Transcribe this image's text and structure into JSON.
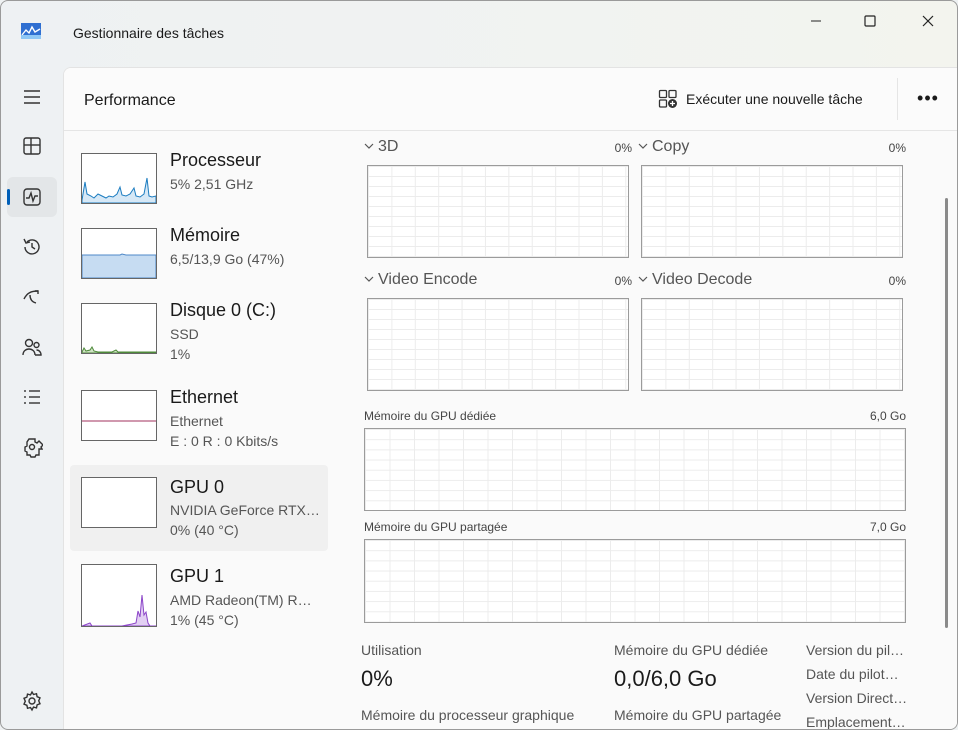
{
  "window": {
    "title": "Gestionnaire des tâches"
  },
  "nav": [
    {
      "name": "menu-icon"
    },
    {
      "name": "processes-icon"
    },
    {
      "name": "performance-icon",
      "active": true
    },
    {
      "name": "history-icon"
    },
    {
      "name": "startup-icon"
    },
    {
      "name": "users-icon"
    },
    {
      "name": "details-icon"
    },
    {
      "name": "services-icon"
    },
    {
      "name": "settings-icon"
    }
  ],
  "header": {
    "title": "Performance",
    "new_task": "Exécuter une nouvelle tâche",
    "more": "•••"
  },
  "resources": [
    {
      "title": "Processeur",
      "lines": [
        "5%  2,51 GHz"
      ]
    },
    {
      "title": "Mémoire",
      "lines": [
        "6,5/13,9 Go (47%)"
      ]
    },
    {
      "title": "Disque 0 (C:)",
      "lines": [
        "SSD",
        "1%"
      ]
    },
    {
      "title": "Ethernet",
      "lines": [
        "Ethernet",
        "E : 0 R : 0 Kbits/s"
      ]
    },
    {
      "title": "GPU 0",
      "lines": [
        "NVIDIA GeForce RTX…",
        "0%  (40 °C)"
      ],
      "selected": true
    },
    {
      "title": "GPU 1",
      "lines": [
        "AMD Radeon(TM) R…",
        "1%  (45 °C)"
      ]
    }
  ],
  "engines": [
    {
      "label": "3D",
      "pct": "0%"
    },
    {
      "label": "Copy",
      "pct": "0%"
    },
    {
      "label": "Video Encode",
      "pct": "0%"
    },
    {
      "label": "Video Decode",
      "pct": "0%"
    }
  ],
  "memory_graphs": [
    {
      "label": "Mémoire du GPU dédiée",
      "max": "6,0 Go"
    },
    {
      "label": "Mémoire du GPU partagée",
      "max": "7,0 Go"
    }
  ],
  "stats": {
    "util_label": "Utilisation",
    "util_value": "0%",
    "ded_label": "Mémoire du GPU dédiée",
    "ded_value": "0,0/6,0 Go",
    "proc_mem_label": "Mémoire du processeur graphique",
    "shared_label": "Mémoire du GPU partagée"
  },
  "info": [
    "Version du pil…",
    "Date du pilot…",
    "Version Direct…",
    "Emplacement…"
  ],
  "colors": {
    "accent": "#005fb8",
    "cpu": "#1b7cc0",
    "memory": "#8fb8e0",
    "disk": "#4e8a3a",
    "ethernet": "#a0325c",
    "gpu1": "#8b44c8"
  }
}
